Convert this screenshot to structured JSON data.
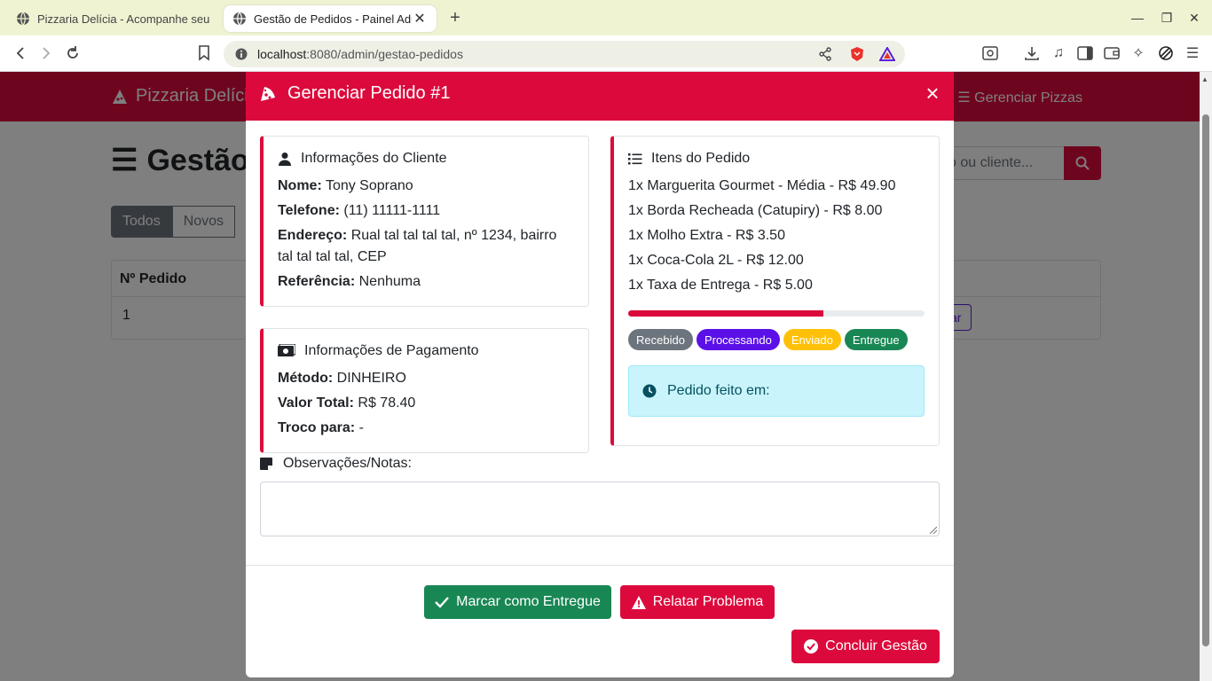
{
  "browser": {
    "tabs": [
      {
        "title": "Pizzaria Delícia - Acompanhe seu Pedido",
        "active": false
      },
      {
        "title": "Gestão de Pedidos - Painel Admin",
        "active": true
      }
    ],
    "new_tab": "+",
    "url_host": "localhost",
    "url_path": ":8080/admin/gestao-pedidos"
  },
  "page": {
    "brand": "Pizzaria Delícia",
    "nav_link_partial": "r",
    "nav_link": "Gerenciar Pizzas",
    "title": "Gestão",
    "filters": [
      "Todos",
      "Novos"
    ],
    "search_placeholder": "o ou cliente...",
    "table_header": "Nº Pedido",
    "table_row_number": "1",
    "row_button_partial": "ar"
  },
  "modal": {
    "title": "Gerenciar Pedido #1",
    "close": "×",
    "customer": {
      "heading": "Informações do Cliente",
      "name_label": "Nome:",
      "name": "Tony Soprano",
      "phone_label": "Telefone:",
      "phone": "(11) 11111-1111",
      "address_label": "Endereço:",
      "address_line1": "Rual tal tal tal tal, nº 1234, bairro",
      "address_line2": "tal tal tal tal, CEP",
      "reference_label": "Referência:",
      "reference": "Nenhuma"
    },
    "payment": {
      "heading": "Informações de Pagamento",
      "method_label": "Método:",
      "method": "DINHEIRO",
      "total_label": "Valor Total:",
      "total": "R$ 78.40",
      "change_label": "Troco para:",
      "change": "-"
    },
    "items": {
      "heading": "Itens do Pedido",
      "list": [
        "1x Marguerita Gourmet - Média - R$ 49.90",
        "1x Borda Recheada (Catupiry) - R$ 8.00",
        "1x Molho Extra - R$ 3.50",
        "1x Coca-Cola 2L - R$ 12.00",
        "1x Taxa de Entrega - R$ 5.00"
      ],
      "progress_fraction": 0.66,
      "statuses": [
        {
          "label": "Recebido",
          "color": "#6c757d"
        },
        {
          "label": "Processando",
          "color": "#5b10e8"
        },
        {
          "label": "Enviado",
          "color": "#ffc107"
        },
        {
          "label": "Entregue",
          "color": "#198754"
        }
      ],
      "ordered_at_label": "Pedido feito em:"
    },
    "notes_label": "Observações/Notas:",
    "notes_value": "",
    "buttons": {
      "mark_delivered": "Marcar como Entregue",
      "report_problem": "Relatar Problema",
      "finish": "Concluir Gestão"
    }
  },
  "colors": {
    "primary": "#dc0a3c",
    "success": "#198754",
    "info_bg": "#c9f4fb"
  }
}
